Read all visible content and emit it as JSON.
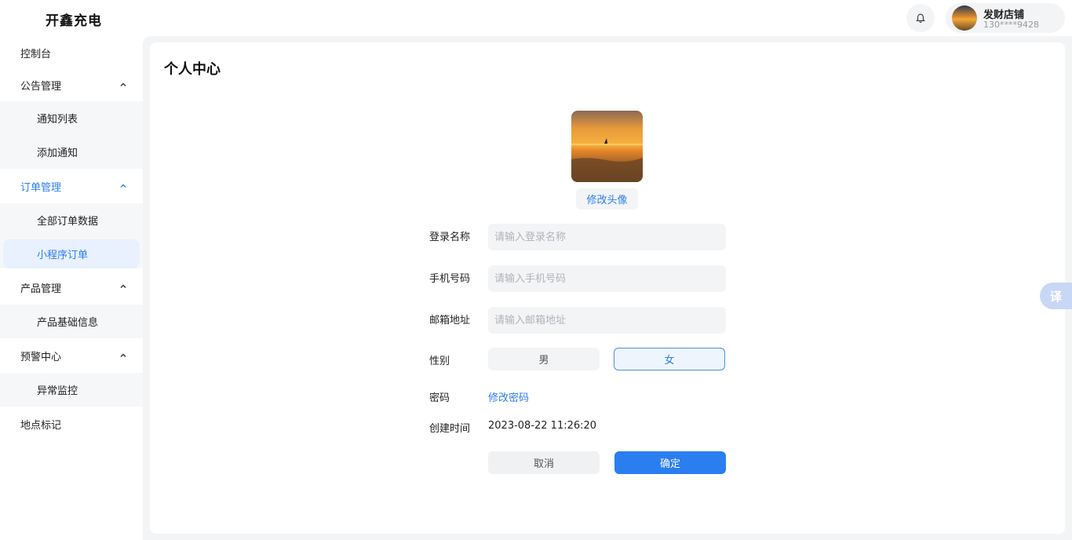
{
  "app": {
    "title": "开鑫充电"
  },
  "header": {
    "user": {
      "name": "发财店铺",
      "phone": "130****9428"
    }
  },
  "sidebar": {
    "items": [
      {
        "label": "控制台"
      },
      {
        "label": "公告管理",
        "children": [
          {
            "label": "通知列表"
          },
          {
            "label": "添加通知"
          }
        ]
      },
      {
        "label": "订单管理",
        "children": [
          {
            "label": "全部订单数据"
          },
          {
            "label": "小程序订单"
          }
        ]
      },
      {
        "label": "产品管理",
        "children": [
          {
            "label": "产品基础信息"
          }
        ]
      },
      {
        "label": "预警中心",
        "children": [
          {
            "label": "异常监控"
          }
        ]
      },
      {
        "label": "地点标记"
      }
    ]
  },
  "page": {
    "title": "个人中心",
    "change_avatar": "修改头像",
    "form": {
      "login_name": {
        "label": "登录名称",
        "placeholder": "请输入登录名称"
      },
      "phone": {
        "label": "手机号码",
        "placeholder": "请输入手机号码"
      },
      "email": {
        "label": "邮箱地址",
        "placeholder": "请输入邮箱地址"
      },
      "gender": {
        "label": "性别",
        "male": "男",
        "female": "女",
        "selected": "女"
      },
      "password": {
        "label": "密码",
        "link": "修改密码"
      },
      "created": {
        "label": "创建时间",
        "value": "2023-08-22 11:26:20"
      }
    },
    "actions": {
      "cancel": "取消",
      "confirm": "确定"
    }
  },
  "translate": {
    "label": "译"
  },
  "colors": {
    "accent": "#2b7ef0",
    "background": "#f3f4f6"
  }
}
